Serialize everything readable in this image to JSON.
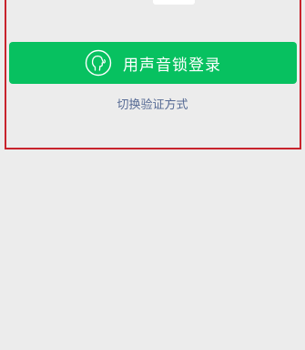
{
  "login": {
    "voice_button_label": "用声音锁登录",
    "switch_method_label": "切换验证方式"
  },
  "icons": {
    "voice_button_icon": "voice-head-icon"
  },
  "colors": {
    "accent": "#07c160",
    "link": "#576b95",
    "highlight": "#c8232c",
    "background": "#ececec"
  }
}
